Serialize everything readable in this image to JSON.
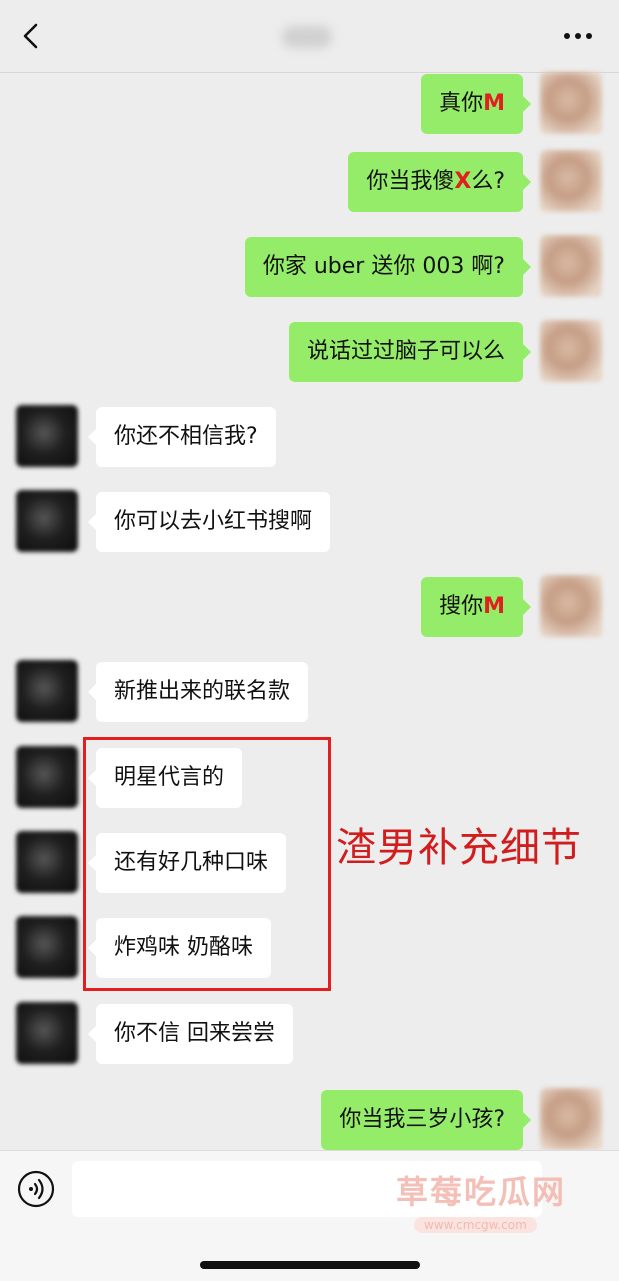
{
  "header": {
    "contact_name": "Ba"
  },
  "messages": [
    {
      "side": "right",
      "parts": [
        {
          "t": "真你"
        },
        {
          "t": "M",
          "red": true
        }
      ]
    },
    {
      "side": "right",
      "parts": [
        {
          "t": "你当我傻"
        },
        {
          "t": "X",
          "red": true
        },
        {
          "t": "么?"
        }
      ]
    },
    {
      "side": "right",
      "parts": [
        {
          "t": "你家 uber 送你 003 啊?"
        }
      ]
    },
    {
      "side": "right",
      "parts": [
        {
          "t": "说话过过脑子可以么"
        }
      ]
    },
    {
      "side": "left",
      "parts": [
        {
          "t": "你还不相信我?"
        }
      ]
    },
    {
      "side": "left",
      "parts": [
        {
          "t": "你可以去小红书搜啊"
        }
      ]
    },
    {
      "side": "right",
      "parts": [
        {
          "t": "搜你"
        },
        {
          "t": "M",
          "red": true
        }
      ]
    },
    {
      "side": "left",
      "parts": [
        {
          "t": "新推出来的联名款"
        }
      ]
    },
    {
      "side": "left",
      "parts": [
        {
          "t": "明星代言的"
        }
      ]
    },
    {
      "side": "left",
      "parts": [
        {
          "t": "还有好几种口味"
        }
      ]
    },
    {
      "side": "left",
      "parts": [
        {
          "t": "炸鸡味 奶酪味"
        }
      ]
    },
    {
      "side": "left",
      "parts": [
        {
          "t": "你不信 回来尝尝"
        }
      ]
    },
    {
      "side": "right",
      "parts": [
        {
          "t": "你当我三岁小孩?"
        }
      ]
    }
  ],
  "annotation": "渣男补充细节",
  "watermark": {
    "main": "草莓吃瓜网",
    "url": "www.cmcgw.com"
  },
  "colors": {
    "outgoing_bubble": "#95ec69",
    "incoming_bubble": "#ffffff",
    "annotation_red": "#e0201e"
  }
}
